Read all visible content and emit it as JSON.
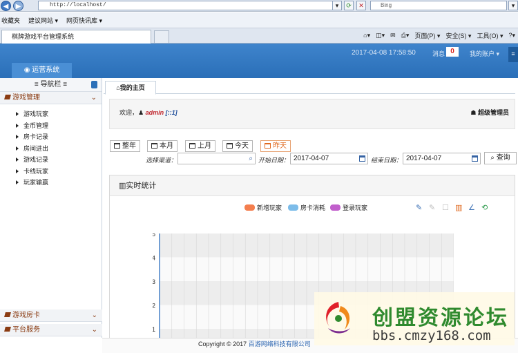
{
  "browser": {
    "url": "http://localhost/",
    "search_placeholder": "Bing",
    "favorites": [
      "收藏夹",
      "建议网站 ▾",
      "网页快讯库 ▾"
    ],
    "tab_title": "棋牌游戏平台管理系统",
    "tools": [
      "页面(P) ▾",
      "安全(S) ▾",
      "工具(O) ▾"
    ]
  },
  "header": {
    "datetime": "2017-04-08 17:58:50",
    "messages_label": "消息",
    "messages_count": "0",
    "account_label": "我的账户 ▾",
    "ops_tab": "运营系统"
  },
  "sidebar": {
    "title": "≡ 导航栏 ≡",
    "sections": [
      {
        "label": "游戏管理",
        "chev": "⌄",
        "items": [
          "游戏玩家",
          "金币管理",
          "房卡记录",
          "房间进出",
          "游戏记录",
          "卡线玩家",
          "玩家输赢"
        ]
      },
      {
        "label": "游戏房卡",
        "chev": "⌄"
      },
      {
        "label": "平台服务",
        "chev": "⌄"
      }
    ]
  },
  "main": {
    "tab_label": "我的主页",
    "welcome_prefix": "欢迎，",
    "username": "admin",
    "ip": "[::1]",
    "role": "超级管理员",
    "filters": [
      "整年",
      "本月",
      "上月",
      "今天",
      "昨天"
    ],
    "active_filter": "昨天",
    "channel_label": "选择渠道：",
    "start_label": "开始日期：",
    "start_date": "2017-04-07",
    "end_label": "结束日期：",
    "end_date": "2017-04-07",
    "query_label": "查询",
    "panel_title": "实时统计"
  },
  "chart_data": {
    "type": "line",
    "series": [
      {
        "name": "新增玩家",
        "color": "#f47e4e",
        "values": []
      },
      {
        "name": "房卡消耗",
        "color": "#7cbce9",
        "values": []
      },
      {
        "name": "登录玩家",
        "color": "#c15fcc",
        "values": []
      }
    ],
    "y_ticks": [
      "5",
      "4",
      "3",
      "2",
      "1"
    ],
    "ylim": [
      0,
      5
    ],
    "grid": true
  },
  "footer": {
    "copyright": "Copyright © 2017",
    "company": "百游网络科技有限公司"
  },
  "watermark": {
    "title": "创盟资源论坛",
    "url": "bbs.cmzy168.com"
  }
}
